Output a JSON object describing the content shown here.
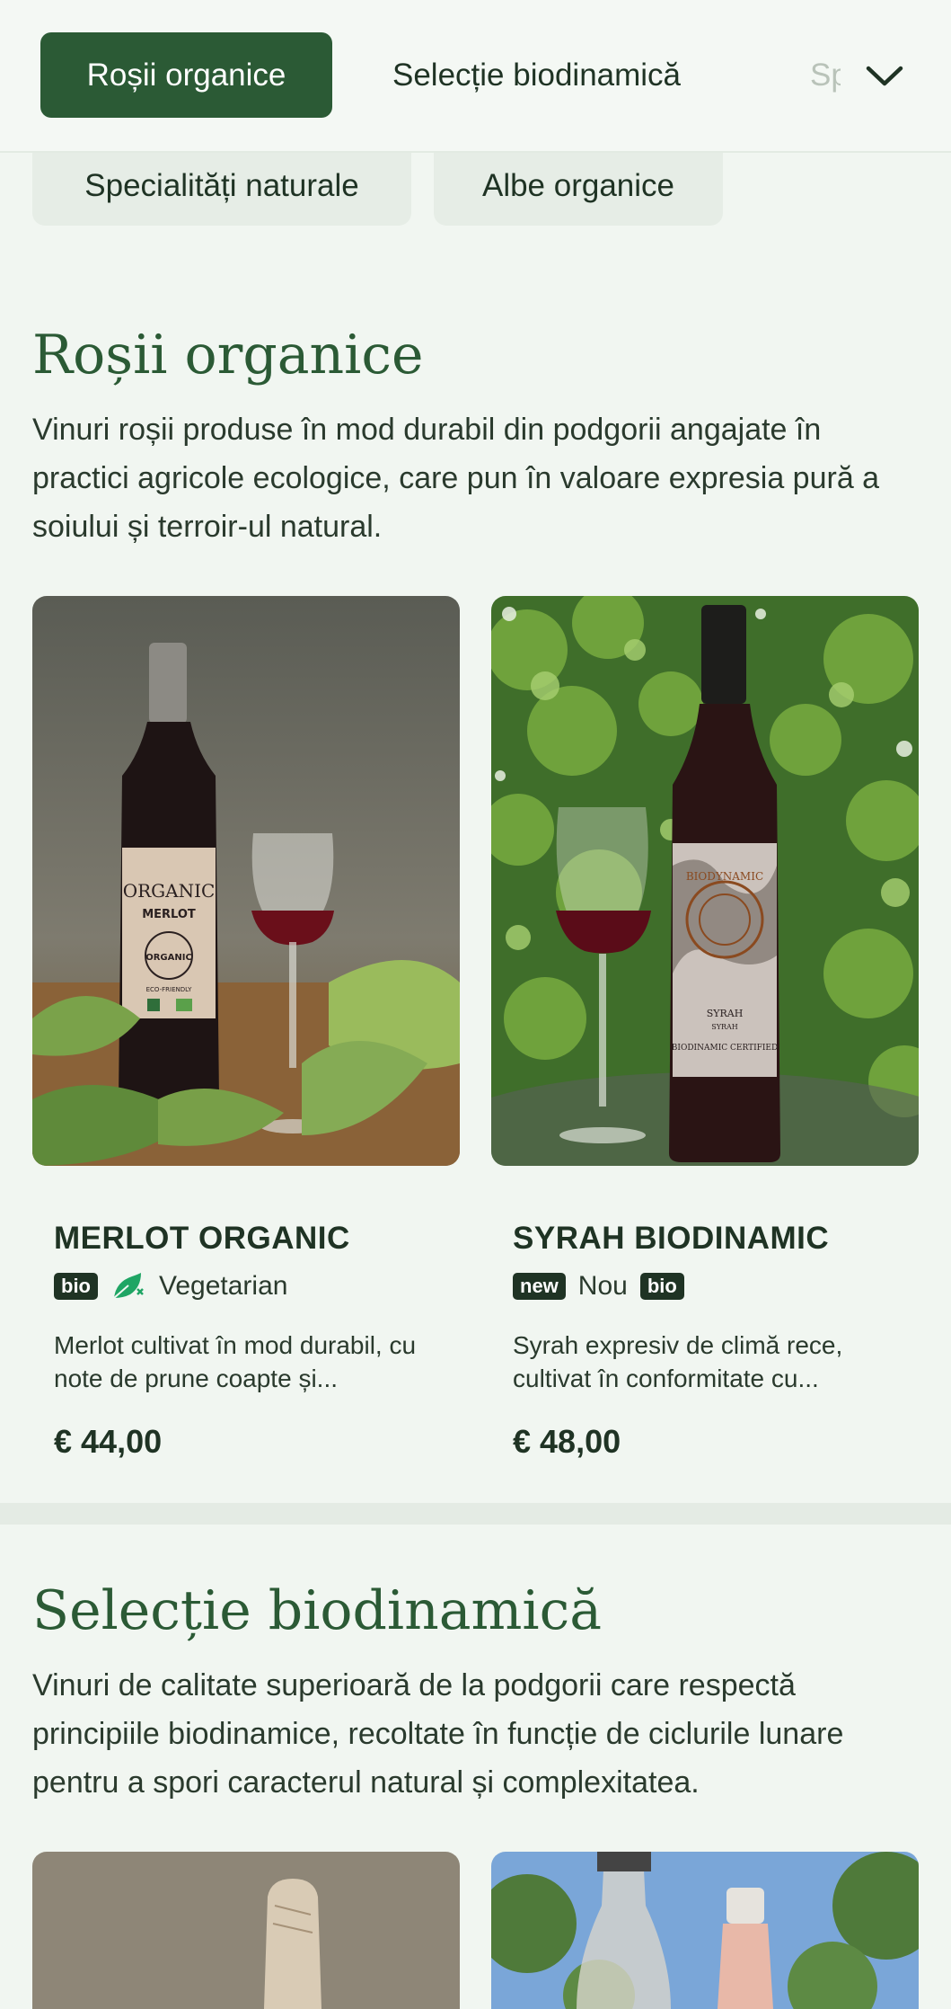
{
  "nav": {
    "tabs": [
      {
        "label": "Roșii organice",
        "active": true
      },
      {
        "label": "Selecție biodinamică",
        "active": false
      },
      {
        "label": "Sp",
        "active": false
      }
    ],
    "second_row": [
      {
        "label": "Specialități naturale"
      },
      {
        "label": "Albe organice"
      }
    ],
    "expand_icon": "chevron-down-icon"
  },
  "sections": [
    {
      "title": "Roșii organice",
      "description": "Vinuri roșii produse în mod durabil din podgorii angajate în practici agricole ecologice, care pun în valoare expresia pură a soiului și terroir-ul natural.",
      "products": [
        {
          "name": "MERLOT ORGANIC",
          "tags": [
            {
              "type": "badge",
              "text": "bio"
            },
            {
              "type": "icon",
              "icon": "leaf-vegetarian-icon",
              "text": "Vegetarian"
            }
          ],
          "description": "Merlot cultivat în mod durabil, cu note de prune coapte și...",
          "price": "€ 44,00",
          "label_lines": [
            "ORGANIC",
            "MERLOT",
            "ORGANIC",
            "ECO-FRIENDLY"
          ]
        },
        {
          "name": "SYRAH BIODINAMIC",
          "tags": [
            {
              "type": "badge",
              "text": "new"
            },
            {
              "type": "text",
              "text": "Nou"
            },
            {
              "type": "badge",
              "text": "bio"
            }
          ],
          "description": "Syrah expresiv de climă rece, cultivat în conformitate cu...",
          "price": "€ 48,00",
          "label_lines": [
            "BIODYNAMIC",
            "SYRAH",
            "SYRAH",
            "BIODINAMIC CERTIFIED"
          ]
        }
      ]
    },
    {
      "title": "Selecție biodinamică",
      "description": "Vinuri de calitate superioară de la podgorii care respectă principiile biodinamice, recoltate în funcție de ciclurile lunare pentru a spori caracterul natural și complexitatea."
    }
  ],
  "colors": {
    "accent": "#2b5a35",
    "background": "#f1f6f1",
    "text": "#1f3324",
    "leaf_icon": "#1fa564"
  }
}
